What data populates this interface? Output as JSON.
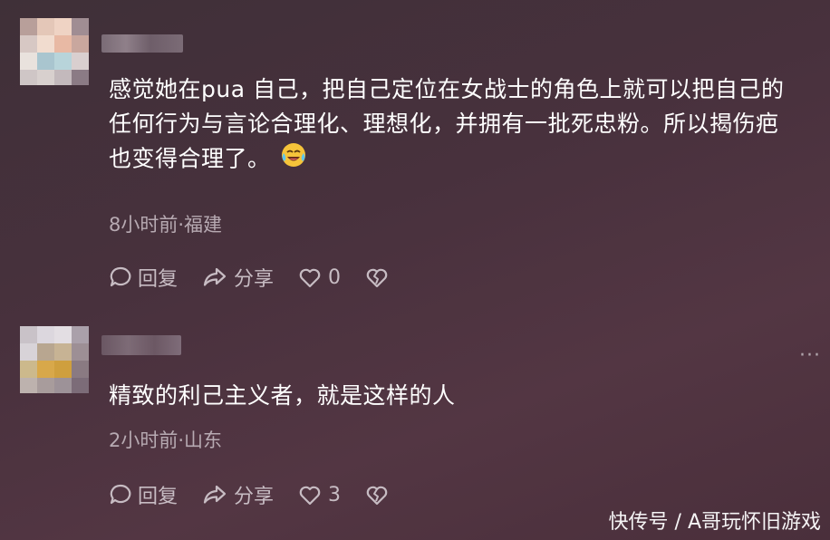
{
  "comments": [
    {
      "text": "感觉她在pua 自己，把自己定位在女战士的角色上就可以把自己的任何行为与言论合理化、理想化，并拥有一批死忠粉。所以揭伤疤也变得合理了。",
      "emoji": "crying-laughing-emoji",
      "meta": "8小时前·福建",
      "reply_label": "回复",
      "share_label": "分享",
      "like_count": "0"
    },
    {
      "text": "精致的利己主义者，就是这样的人",
      "meta": "2小时前·山东",
      "reply_label": "回复",
      "share_label": "分享",
      "like_count": "3",
      "more_label": "···"
    }
  ],
  "watermark": "快传号 / A哥玩怀旧游戏",
  "colors": {
    "background": "#48313d",
    "text": "#ffffff",
    "meta": "#b7aab2",
    "actions": "#c7bcc3"
  }
}
